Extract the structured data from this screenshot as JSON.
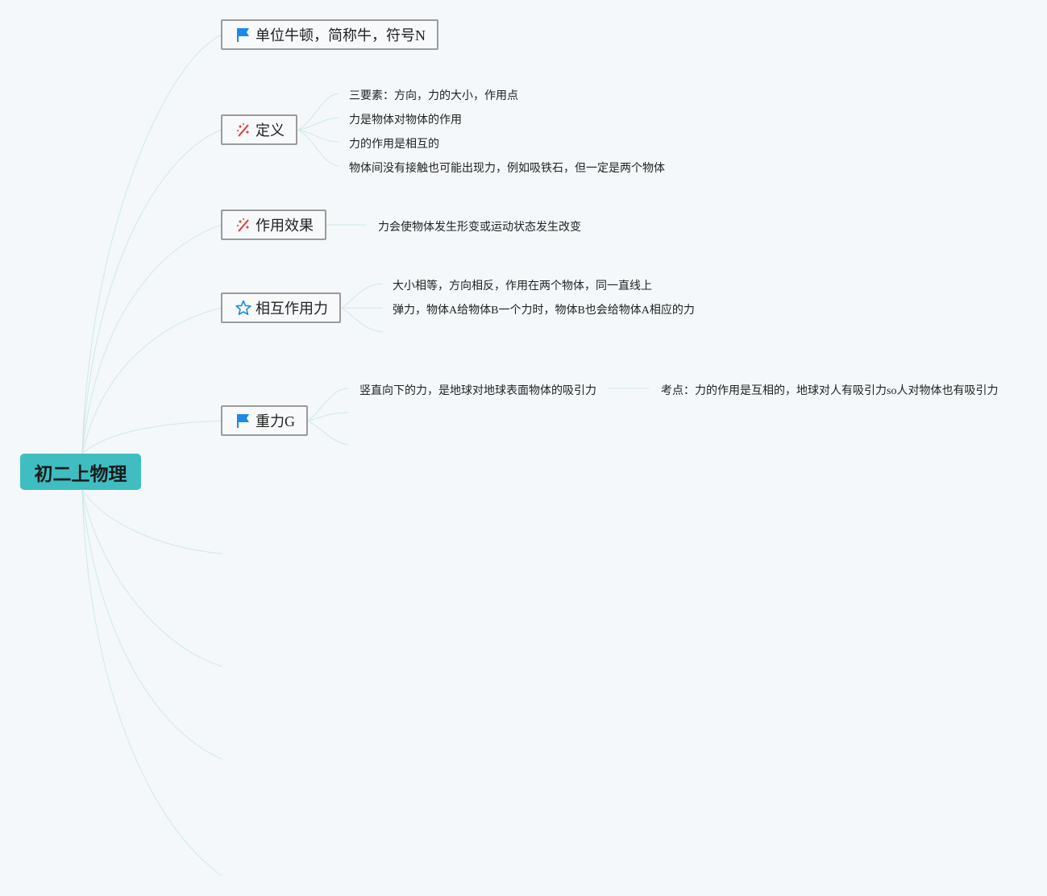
{
  "root": {
    "label": "初二上物理"
  },
  "topics": [
    {
      "label": "单位牛顿，简称牛，符号N",
      "icon": "flag-icon",
      "children": []
    },
    {
      "label": "定义",
      "icon": "sparkle-icon",
      "children": [
        "三要素：方向，力的大小，作用点",
        "力是物体对物体的作用",
        "力的作用是相互的",
        "物体间没有接触也可能出现力，例如吸铁石，但一定是两个物体"
      ]
    },
    {
      "label": "作用效果",
      "icon": "sparkle-icon",
      "children": [
        "力会使物体发生形变或运动状态发生改变"
      ]
    },
    {
      "label": "相互作用力",
      "icon": "star-icon",
      "children": [
        "大小相等，方向相反，作用在两个物体，同一直线上",
        "弹力，物体A给物体B一个力时，物体B也会给物体A相应的力"
      ]
    },
    {
      "label": "重力G",
      "icon": "flag-icon",
      "children": [
        "竖直向下的力，是地球对地球表面物体的吸引力"
      ],
      "subnote": "考点：力的作用是互相的，地球对人有吸引力so人对物体也有吸引力"
    }
  ],
  "colors": {
    "root_bg": "#3fbdc0",
    "connector": "#cfe8e7",
    "flag": "#1e88e5",
    "sparkle": "#e53935",
    "star": "#1e88e5"
  }
}
